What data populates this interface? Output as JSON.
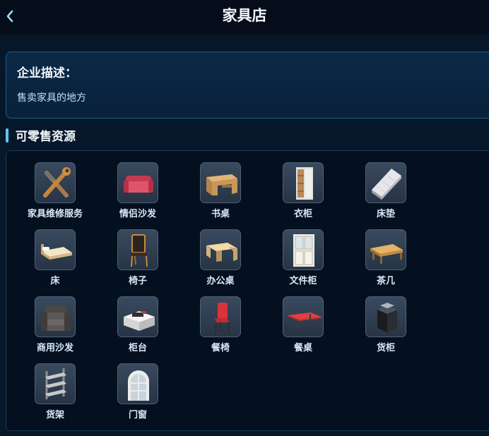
{
  "header": {
    "title": "家具店",
    "back_icon": "chevron-left-icon"
  },
  "description": {
    "heading": "企业描述：",
    "text": "售卖家具的地方"
  },
  "section": {
    "title": "可零售资源"
  },
  "items": [
    {
      "label": "家具维修服务",
      "icon": "wrench-screwdriver-icon"
    },
    {
      "label": "情侣沙发",
      "icon": "sofa-icon"
    },
    {
      "label": "书桌",
      "icon": "desk-icon"
    },
    {
      "label": "衣柜",
      "icon": "wardrobe-icon"
    },
    {
      "label": "床垫",
      "icon": "mattress-icon"
    },
    {
      "label": "床",
      "icon": "bed-icon"
    },
    {
      "label": "椅子",
      "icon": "chair-icon"
    },
    {
      "label": "办公桌",
      "icon": "office-desk-icon"
    },
    {
      "label": "文件柜",
      "icon": "file-cabinet-icon"
    },
    {
      "label": "茶几",
      "icon": "coffee-table-icon"
    },
    {
      "label": "商用沙发",
      "icon": "armchair-icon"
    },
    {
      "label": "柜台",
      "icon": "counter-icon"
    },
    {
      "label": "餐椅",
      "icon": "dining-chair-icon"
    },
    {
      "label": "餐桌",
      "icon": "dining-table-icon"
    },
    {
      "label": "货柜",
      "icon": "display-cabinet-icon"
    },
    {
      "label": "货架",
      "icon": "shelf-icon"
    },
    {
      "label": "门窗",
      "icon": "window-icon"
    }
  ]
}
